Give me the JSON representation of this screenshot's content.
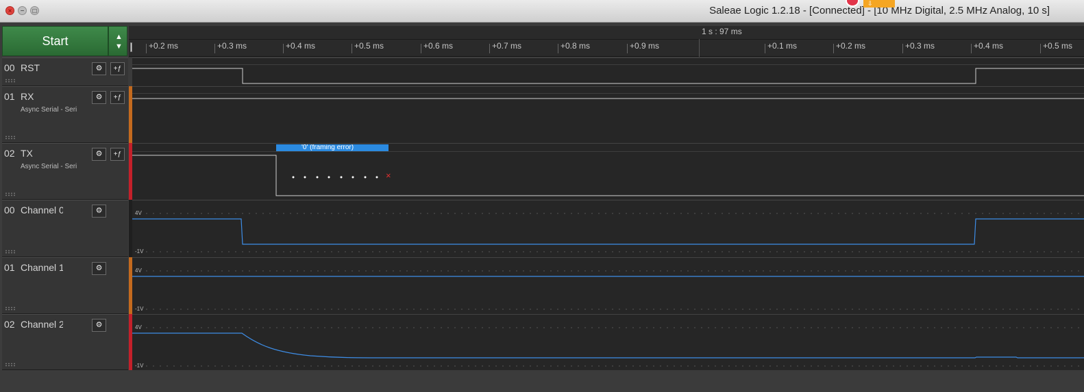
{
  "window": {
    "title": "Saleae Logic 1.2.18 - [Connected] - [10 MHz Digital, 2.5 MHz Analog, 10 s]",
    "close_glyph": "×",
    "min_glyph": "−",
    "max_glyph": "□"
  },
  "toolbar": {
    "start_label": "Start",
    "up_arrow": "▲",
    "down_arrow": "▼"
  },
  "ruler": {
    "reference": "1 s : 97 ms",
    "ticks_left": [
      "+0.2 ms",
      "+0.3 ms",
      "+0.4 ms",
      "+0.5 ms",
      "+0.6 ms",
      "+0.7 ms",
      "+0.8 ms",
      "+0.9 ms"
    ],
    "ticks_right": [
      "+0.1 ms",
      "+0.2 ms",
      "+0.3 ms",
      "+0.4 ms",
      "+0.5 ms"
    ]
  },
  "channels": [
    {
      "num": "00",
      "name": "RST",
      "sub": "",
      "type": "digital",
      "color": "#1f1f1f"
    },
    {
      "num": "01",
      "name": "RX",
      "sub": "Async Serial - Seri",
      "type": "digital",
      "color": "#c46a1e"
    },
    {
      "num": "02",
      "name": "TX",
      "sub": "Async Serial - Seri",
      "type": "digital",
      "color": "#c4202a"
    },
    {
      "num": "00",
      "name": "Channel 0",
      "sub": "",
      "type": "analog",
      "color": "#1f1f1f"
    },
    {
      "num": "01",
      "name": "Channel 1",
      "sub": "",
      "type": "analog",
      "color": "#c46a1e"
    },
    {
      "num": "02",
      "name": "Channel 2",
      "sub": "",
      "type": "analog",
      "color": "#c4202a"
    }
  ],
  "icons": {
    "gear": "⚙",
    "trigger": "+ƒ"
  },
  "tx_annotation": "'0' (framing error)",
  "error_marker": "×",
  "analog_scale": {
    "top": "4V",
    "bottom": "-1V"
  },
  "overlay": {
    "label": "⇩"
  },
  "colors": {
    "accent": "#2b8ae0",
    "start_green": "#347b3e",
    "wave_digital": "#d0d0d0",
    "wave_analog": "#3e8ee8"
  }
}
